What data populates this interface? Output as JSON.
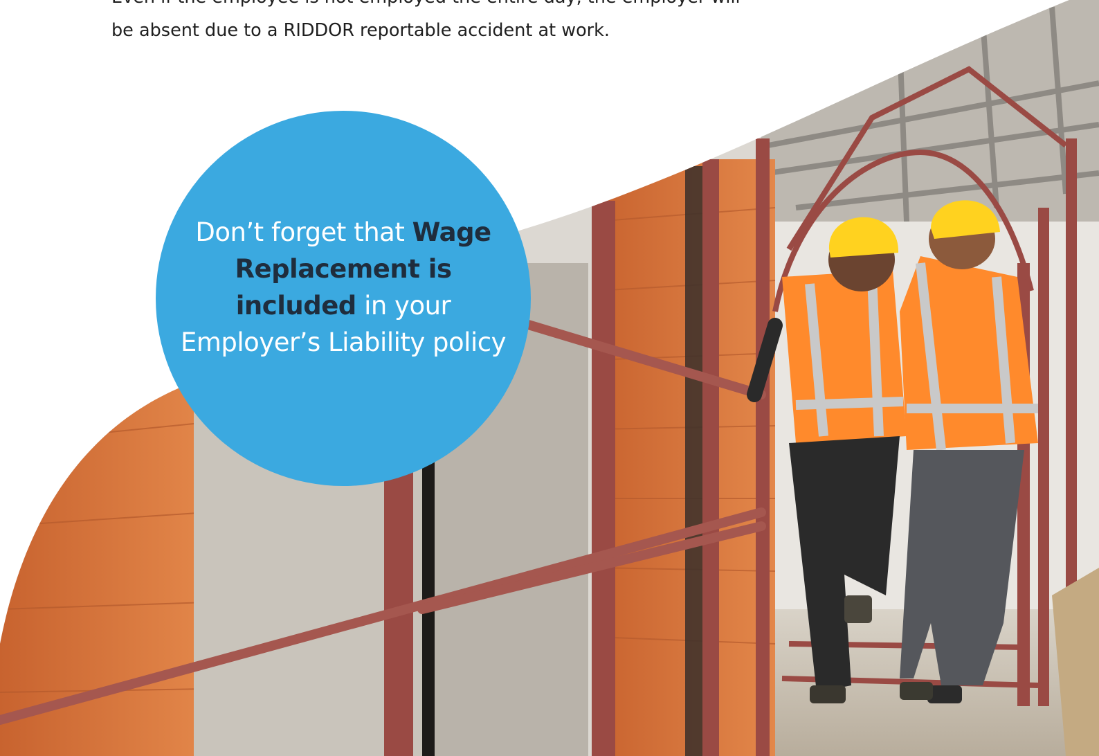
{
  "intro": {
    "line_partial": "Even if the employee is not employed the entire day, the employer will",
    "line_full": "be absent due to a RIDDOR reportable accident at work."
  },
  "callout": {
    "part1": "Don’t forget that",
    "bold": "Wage Replacement is included",
    "part2": "in your Employer’s Liability policy"
  },
  "colors": {
    "callout_bg": "#3ba9e0",
    "callout_text": "#ffffff",
    "callout_bold_text": "#1f2d3d",
    "brick": "#d9783f",
    "scaffold": "#9a4a44",
    "hi_vis": "#ff8a2c",
    "hard_hat": "#ffd21f"
  },
  "image": {
    "subject": "two construction workers on scaffolding, one helping an injured colleague walk"
  }
}
